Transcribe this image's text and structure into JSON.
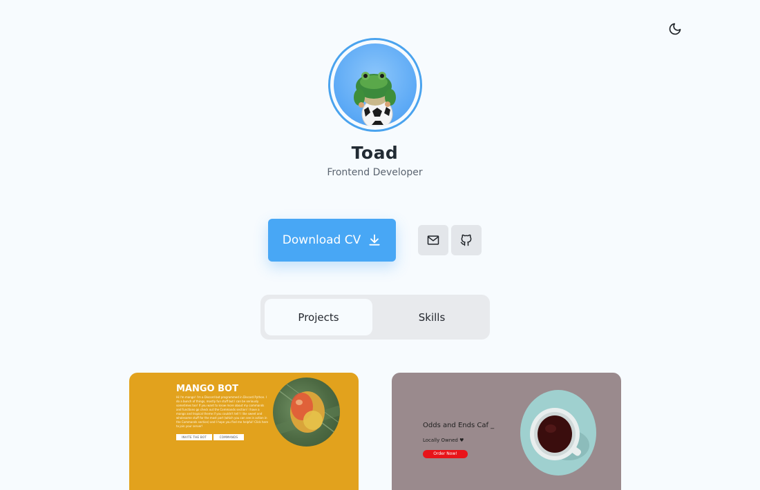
{
  "header": {
    "theme_toggle_icon": "moon-icon"
  },
  "profile": {
    "name": "Toad",
    "role": "Frontend Developer",
    "avatar_icon": "frog-on-soccer-ball-avatar",
    "avatar_ring_color": "#4aa3ee"
  },
  "actions": {
    "download_cv_label": "Download CV",
    "download_icon": "download-icon",
    "mail_icon": "mail-icon",
    "github_icon": "github-icon",
    "accent_color": "#48a7f5"
  },
  "tabs": [
    {
      "label": "Projects",
      "active": true
    },
    {
      "label": "Skills",
      "active": false
    }
  ],
  "projects": [
    {
      "title": "MANGO BOT",
      "description": "Hi I'm mango! I'm a Discord bot programmed in Discord Python. I do a bunch of things, mostly fun stuff but I can be seriously sometimes too! If you want to know more about my commands and functions go check out the Commands section! I have a mango and tropical theme if you couldn't tell! I like sweet and wholesome stuff for the most part (which you can see in action in the Commands section) and I hope you find me helpful! Click here to join your server!",
      "buttons": [
        "INVITE THE BOT",
        "COMMANDS"
      ],
      "background": "#e2a21d",
      "image_icon": "mango-image"
    },
    {
      "title": "Odds and Ends Caf _",
      "subtitle": "Locally Owned ♥",
      "button": "Order Now!",
      "background": "#9a8a8d",
      "image_icon": "coffee-cup-image"
    }
  ]
}
